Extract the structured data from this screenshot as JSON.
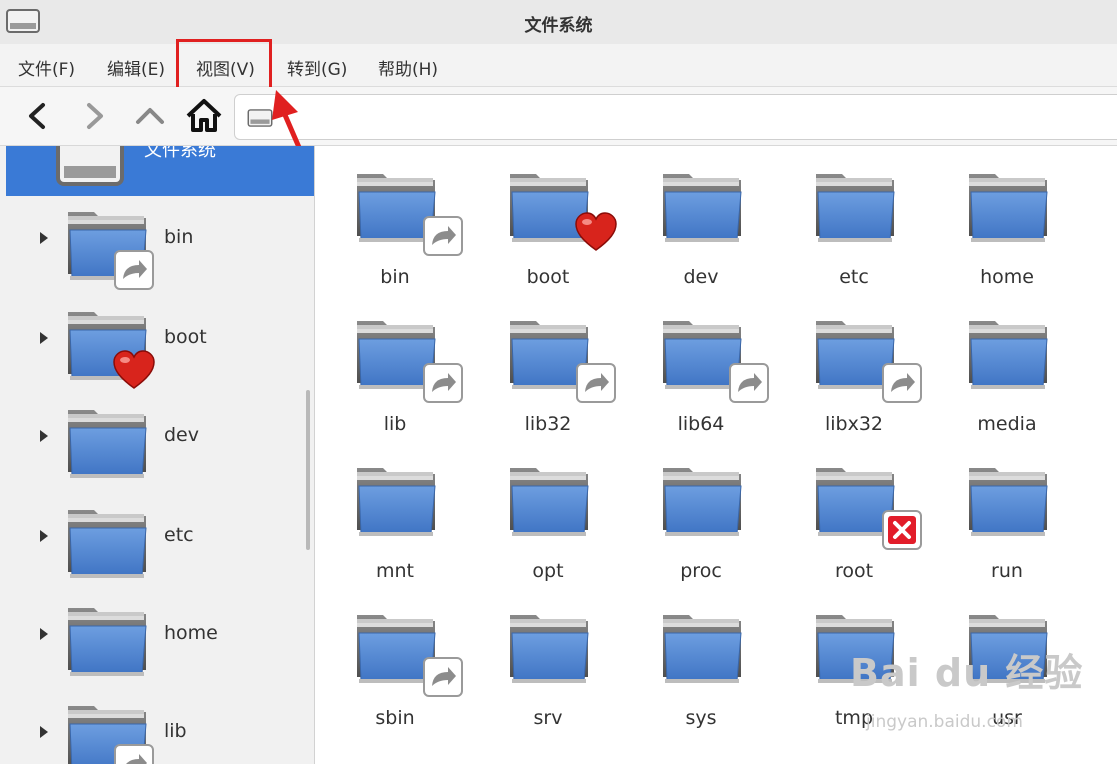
{
  "window": {
    "title": "文件系统"
  },
  "menu": {
    "items": [
      {
        "label": "文件(F)"
      },
      {
        "label": "编辑(E)"
      },
      {
        "label": "视图(V)"
      },
      {
        "label": "转到(G)"
      },
      {
        "label": "帮助(H)"
      }
    ],
    "highlighted": "视图(V)"
  },
  "toolbar": {
    "back_icon": "chevron-left-icon",
    "forward_icon": "chevron-right-icon",
    "up_icon": "chevron-up-icon",
    "home_icon": "home-icon"
  },
  "sidebar": {
    "selected_label": "文件系统",
    "items": [
      {
        "label": "bin",
        "emblem": "symlink"
      },
      {
        "label": "boot",
        "emblem": "heart"
      },
      {
        "label": "dev",
        "emblem": ""
      },
      {
        "label": "etc",
        "emblem": ""
      },
      {
        "label": "home",
        "emblem": ""
      },
      {
        "label": "lib",
        "emblem": "symlink"
      }
    ]
  },
  "files": [
    {
      "label": "bin",
      "emblem": "symlink"
    },
    {
      "label": "boot",
      "emblem": "heart"
    },
    {
      "label": "dev",
      "emblem": ""
    },
    {
      "label": "etc",
      "emblem": ""
    },
    {
      "label": "home",
      "emblem": ""
    },
    {
      "label": "lib",
      "emblem": "symlink"
    },
    {
      "label": "lib32",
      "emblem": "symlink"
    },
    {
      "label": "lib64",
      "emblem": "symlink"
    },
    {
      "label": "libx32",
      "emblem": "symlink"
    },
    {
      "label": "media",
      "emblem": ""
    },
    {
      "label": "mnt",
      "emblem": ""
    },
    {
      "label": "opt",
      "emblem": ""
    },
    {
      "label": "proc",
      "emblem": ""
    },
    {
      "label": "root",
      "emblem": "no-access"
    },
    {
      "label": "run",
      "emblem": ""
    },
    {
      "label": "sbin",
      "emblem": "symlink"
    },
    {
      "label": "srv",
      "emblem": ""
    },
    {
      "label": "sys",
      "emblem": ""
    },
    {
      "label": "tmp",
      "emblem": ""
    },
    {
      "label": "usr",
      "emblem": ""
    }
  ],
  "watermark": {
    "text": "Bai du 经验",
    "sub": "jingyan.baidu.com"
  },
  "colors": {
    "accent": "#3a7ad6",
    "highlight": "#e02020",
    "folder": "#5b8fd8"
  }
}
